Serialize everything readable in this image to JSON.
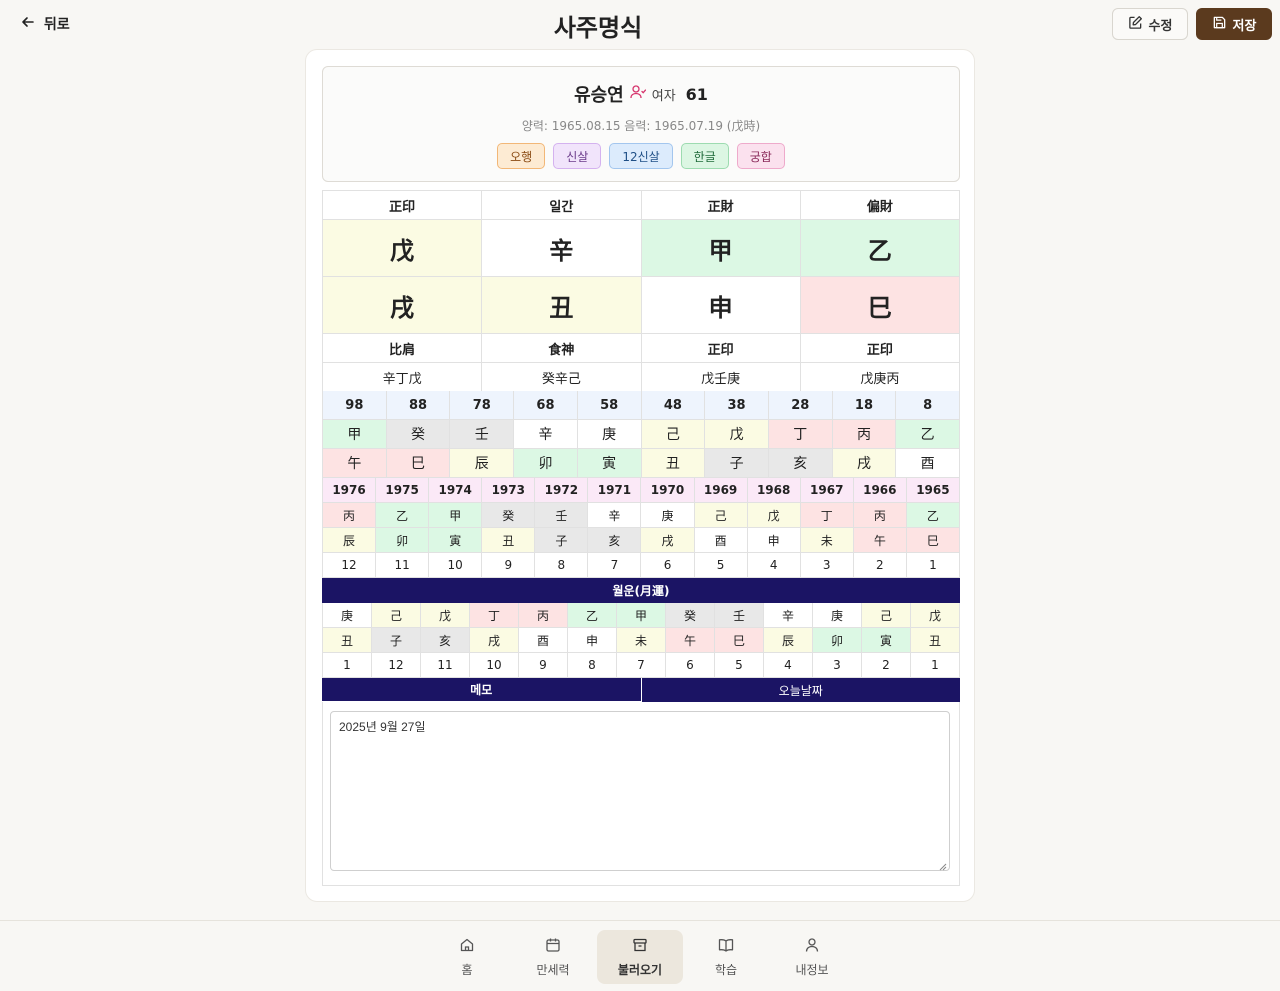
{
  "header": {
    "back_label": "뒤로",
    "title": "사주명식",
    "edit_label": "수정",
    "save_label": "저장"
  },
  "profile": {
    "name": "유승연",
    "gender": "여자",
    "age": "61",
    "dates": "양력: 1965.08.15 음력: 1965.07.19 (戊時)",
    "tags": [
      {
        "label": "오행",
        "bg": "#fdebd3",
        "border": "#f2b777",
        "color": "#8a4a12"
      },
      {
        "label": "신살",
        "bg": "#f1e4fb",
        "border": "#d4b2ef",
        "color": "#6a3a8a"
      },
      {
        "label": "12신살",
        "bg": "#dcebfc",
        "border": "#a3c6ee",
        "color": "#1f4f86"
      },
      {
        "label": "한글",
        "bg": "#dcf6e3",
        "border": "#9ddbb0",
        "color": "#1f6a3a"
      },
      {
        "label": "궁합",
        "bg": "#fbe1ee",
        "border": "#eeaacb",
        "color": "#8a2a5a"
      }
    ]
  },
  "pillars": {
    "top_labels": [
      "正印",
      "일간",
      "正財",
      "偏財"
    ],
    "stems": [
      {
        "char": "戊",
        "bg": "#fbfbe3"
      },
      {
        "char": "辛",
        "bg": "#ffffff"
      },
      {
        "char": "甲",
        "bg": "#dcf8e4"
      },
      {
        "char": "乙",
        "bg": "#dcf8e4"
      }
    ],
    "branches": [
      {
        "char": "戌",
        "bg": "#fbfbe3"
      },
      {
        "char": "丑",
        "bg": "#fbfbe3"
      },
      {
        "char": "申",
        "bg": "#ffffff"
      },
      {
        "char": "巳",
        "bg": "#fde3e3"
      }
    ],
    "bottom_labels": [
      "比肩",
      "食神",
      "正印",
      "正印"
    ],
    "hidden": [
      "辛丁戊",
      "癸辛己",
      "戊壬庚",
      "戊庚丙"
    ]
  },
  "daeun": {
    "ages": [
      "98",
      "88",
      "78",
      "68",
      "58",
      "48",
      "38",
      "28",
      "18",
      "8"
    ],
    "stems": [
      {
        "char": "甲",
        "bg": "#dcf8e4"
      },
      {
        "char": "癸",
        "bg": "#e8e8e8"
      },
      {
        "char": "壬",
        "bg": "#e8e8e8"
      },
      {
        "char": "辛",
        "bg": "#ffffff"
      },
      {
        "char": "庚",
        "bg": "#ffffff"
      },
      {
        "char": "己",
        "bg": "#fbfbe3"
      },
      {
        "char": "戊",
        "bg": "#fbfbe3"
      },
      {
        "char": "丁",
        "bg": "#fde3e3"
      },
      {
        "char": "丙",
        "bg": "#fde3e3"
      },
      {
        "char": "乙",
        "bg": "#dcf8e4"
      }
    ],
    "branches": [
      {
        "char": "午",
        "bg": "#fde3e3"
      },
      {
        "char": "巳",
        "bg": "#fde3e3"
      },
      {
        "char": "辰",
        "bg": "#fbfbe3"
      },
      {
        "char": "卯",
        "bg": "#dcf8e4"
      },
      {
        "char": "寅",
        "bg": "#dcf8e4"
      },
      {
        "char": "丑",
        "bg": "#fbfbe3"
      },
      {
        "char": "子",
        "bg": "#e8e8e8"
      },
      {
        "char": "亥",
        "bg": "#e8e8e8"
      },
      {
        "char": "戌",
        "bg": "#fbfbe3"
      },
      {
        "char": "酉",
        "bg": "#ffffff"
      }
    ]
  },
  "seun": {
    "years": [
      "1976",
      "1975",
      "1974",
      "1973",
      "1972",
      "1971",
      "1970",
      "1969",
      "1968",
      "1967",
      "1966",
      "1965"
    ],
    "stems": [
      {
        "char": "丙",
        "bg": "#fde3e3"
      },
      {
        "char": "乙",
        "bg": "#dcf8e4"
      },
      {
        "char": "甲",
        "bg": "#dcf8e4"
      },
      {
        "char": "癸",
        "bg": "#e8e8e8"
      },
      {
        "char": "壬",
        "bg": "#e8e8e8"
      },
      {
        "char": "辛",
        "bg": "#ffffff"
      },
      {
        "char": "庚",
        "bg": "#ffffff"
      },
      {
        "char": "己",
        "bg": "#fbfbe3"
      },
      {
        "char": "戊",
        "bg": "#fbfbe3"
      },
      {
        "char": "丁",
        "bg": "#fde3e3"
      },
      {
        "char": "丙",
        "bg": "#fde3e3"
      },
      {
        "char": "乙",
        "bg": "#dcf8e4"
      }
    ],
    "branches": [
      {
        "char": "辰",
        "bg": "#fbfbe3"
      },
      {
        "char": "卯",
        "bg": "#dcf8e4"
      },
      {
        "char": "寅",
        "bg": "#dcf8e4"
      },
      {
        "char": "丑",
        "bg": "#fbfbe3"
      },
      {
        "char": "子",
        "bg": "#e8e8e8"
      },
      {
        "char": "亥",
        "bg": "#e8e8e8"
      },
      {
        "char": "戌",
        "bg": "#fbfbe3"
      },
      {
        "char": "酉",
        "bg": "#ffffff"
      },
      {
        "char": "申",
        "bg": "#ffffff"
      },
      {
        "char": "未",
        "bg": "#fbfbe3"
      },
      {
        "char": "午",
        "bg": "#fde3e3"
      },
      {
        "char": "巳",
        "bg": "#fde3e3"
      }
    ],
    "nums": [
      "12",
      "11",
      "10",
      "9",
      "8",
      "7",
      "6",
      "5",
      "4",
      "3",
      "2",
      "1"
    ]
  },
  "wolun": {
    "header": "월운(月運)",
    "stems": [
      {
        "char": "庚",
        "bg": "#ffffff"
      },
      {
        "char": "己",
        "bg": "#fbfbe3"
      },
      {
        "char": "戊",
        "bg": "#fbfbe3"
      },
      {
        "char": "丁",
        "bg": "#fde3e3"
      },
      {
        "char": "丙",
        "bg": "#fde3e3"
      },
      {
        "char": "乙",
        "bg": "#dcf8e4"
      },
      {
        "char": "甲",
        "bg": "#dcf8e4"
      },
      {
        "char": "癸",
        "bg": "#e8e8e8"
      },
      {
        "char": "壬",
        "bg": "#e8e8e8"
      },
      {
        "char": "辛",
        "bg": "#ffffff"
      },
      {
        "char": "庚",
        "bg": "#ffffff"
      },
      {
        "char": "己",
        "bg": "#fbfbe3"
      },
      {
        "char": "戊",
        "bg": "#fbfbe3"
      }
    ],
    "branches": [
      {
        "char": "丑",
        "bg": "#fbfbe3"
      },
      {
        "char": "子",
        "bg": "#e8e8e8"
      },
      {
        "char": "亥",
        "bg": "#e8e8e8"
      },
      {
        "char": "戌",
        "bg": "#fbfbe3"
      },
      {
        "char": "酉",
        "bg": "#ffffff"
      },
      {
        "char": "申",
        "bg": "#ffffff"
      },
      {
        "char": "未",
        "bg": "#fbfbe3"
      },
      {
        "char": "午",
        "bg": "#fde3e3"
      },
      {
        "char": "巳",
        "bg": "#fde3e3"
      },
      {
        "char": "辰",
        "bg": "#fbfbe3"
      },
      {
        "char": "卯",
        "bg": "#dcf8e4"
      },
      {
        "char": "寅",
        "bg": "#dcf8e4"
      },
      {
        "char": "丑",
        "bg": "#fbfbe3"
      }
    ],
    "nums": [
      "1",
      "12",
      "11",
      "10",
      "9",
      "8",
      "7",
      "6",
      "5",
      "4",
      "3",
      "2",
      "1"
    ]
  },
  "memo": {
    "label": "메모",
    "today_label": "오늘날짜",
    "value": "2025년 9월 27일"
  },
  "nav": {
    "items": [
      {
        "label": "홈"
      },
      {
        "label": "만세력"
      },
      {
        "label": "불러오기"
      },
      {
        "label": "학습"
      },
      {
        "label": "내정보"
      }
    ]
  },
  "colors": {
    "accent_brown": "#5b3a1e",
    "navy": "#1b1464",
    "age_row": "#eef4fd",
    "year_row": "#fbe9f7",
    "gender_icon": "#d6336c"
  }
}
